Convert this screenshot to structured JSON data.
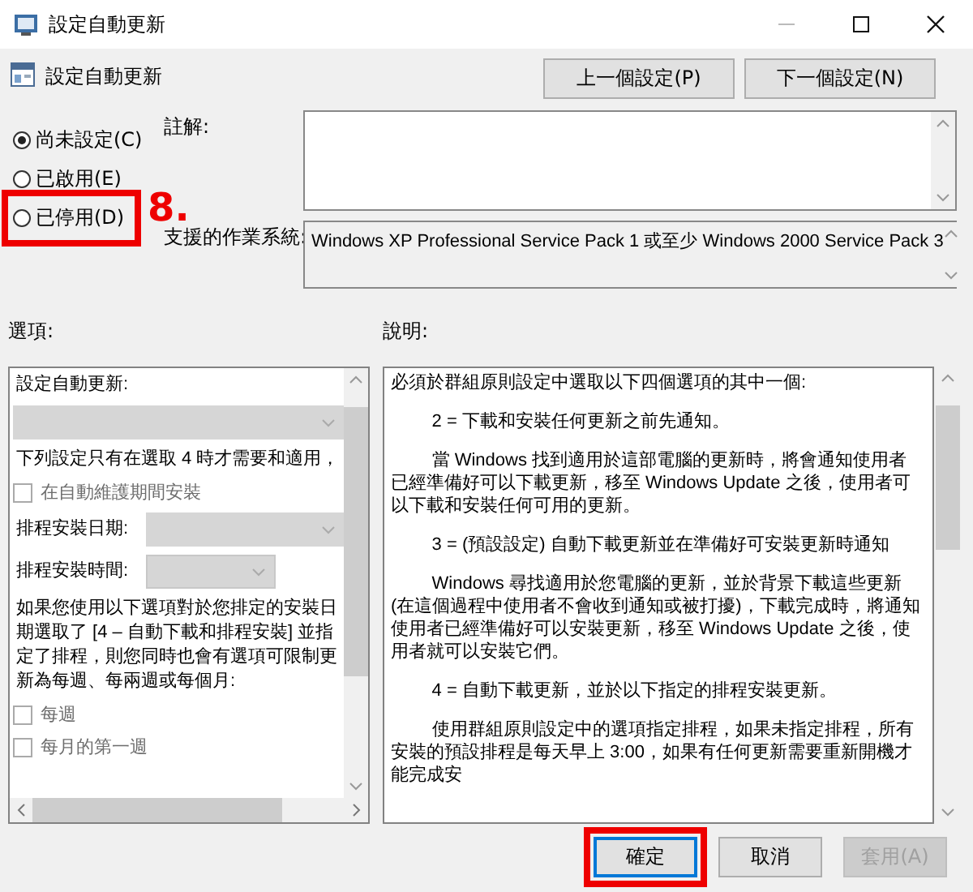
{
  "window": {
    "title": "設定自動更新"
  },
  "header": {
    "title": "設定自動更新"
  },
  "nav_buttons": [
    {
      "label": "上一個設定(P)"
    },
    {
      "label": "下一個設定(N)"
    }
  ],
  "state_options": [
    {
      "label": "尚未設定(C)",
      "selected": true,
      "highlighted": false
    },
    {
      "label": "已啟用(E)",
      "selected": false,
      "highlighted": false
    },
    {
      "label": "已停用(D)",
      "selected": false,
      "highlighted": true,
      "step": "8."
    }
  ],
  "comment": {
    "label": "註解:"
  },
  "supported_on": {
    "label": "支援的作業系統:",
    "value": "Windows XP Professional Service Pack 1 或至少 Windows 2000 Service Pack 3"
  },
  "options": {
    "label": "選項:",
    "items": [
      {
        "kind": "label",
        "text": "設定自動更新:"
      },
      {
        "kind": "dropdown",
        "disabled": true
      },
      {
        "kind": "label",
        "text": "下列設定只有在選取 4 時才需要和適用，"
      },
      {
        "kind": "checkbox",
        "text": "在自動維護期間安裝",
        "checked": false,
        "disabled": true
      },
      {
        "kind": "labeled_dropdown",
        "text": "排程安裝日期:",
        "disabled": true
      },
      {
        "kind": "labeled_dropdown",
        "text": "排程安裝時間:",
        "disabled": true
      },
      {
        "kind": "label",
        "text": "如果您使用以下選項對於您排定的安裝日期選取了 [4 – 自動下載和排程安裝] 並指定了排程，則您同時也會有選項可限制更新為每週、每兩週或每個月:"
      },
      {
        "kind": "checkbox",
        "text": "每週",
        "checked": false,
        "disabled": true
      },
      {
        "kind": "checkbox",
        "text": "每月的第一週",
        "checked": false,
        "disabled": true
      }
    ]
  },
  "help": {
    "label": "說明:",
    "paragraphs": [
      {
        "text": "必須於群組原則設定中選取以下四個選項的其中一個:",
        "indent": false
      },
      {
        "text": "2 = 下載和安裝任何更新之前先通知。",
        "indent": true
      },
      {
        "text": "當 Windows 找到適用於這部電腦的更新時，將會通知使用者已經準備好可以下載更新，移至 Windows Update 之後，使用者可以下載和安裝任何可用的更新。",
        "indent": true
      },
      {
        "text": "3 = (預設設定) 自動下載更新並在準備好可安裝更新時通知",
        "indent": true
      },
      {
        "text": "Windows 尋找適用於您電腦的更新，並於背景下載這些更新 (在這個過程中使用者不會收到通知或被打擾)，下載完成時，將通知使用者已經準備好可以安裝更新，移至 Windows Update 之後，使用者就可以安裝它們。",
        "indent": true
      },
      {
        "text": "4 = 自動下載更新，並於以下指定的排程安裝更新。",
        "indent": true
      },
      {
        "text": "使用群組原則設定中的選項指定排程，如果未指定排程，所有安裝的預設排程是每天早上 3:00，如果有任何更新需要重新開機才能完成安",
        "indent": true
      }
    ]
  },
  "buttons": [
    {
      "label": "確定",
      "default": true,
      "disabled": false,
      "highlighted": true
    },
    {
      "label": "取消",
      "default": false,
      "disabled": false,
      "highlighted": false
    },
    {
      "label": "套用(A)",
      "default": false,
      "disabled": true,
      "highlighted": false
    }
  ]
}
